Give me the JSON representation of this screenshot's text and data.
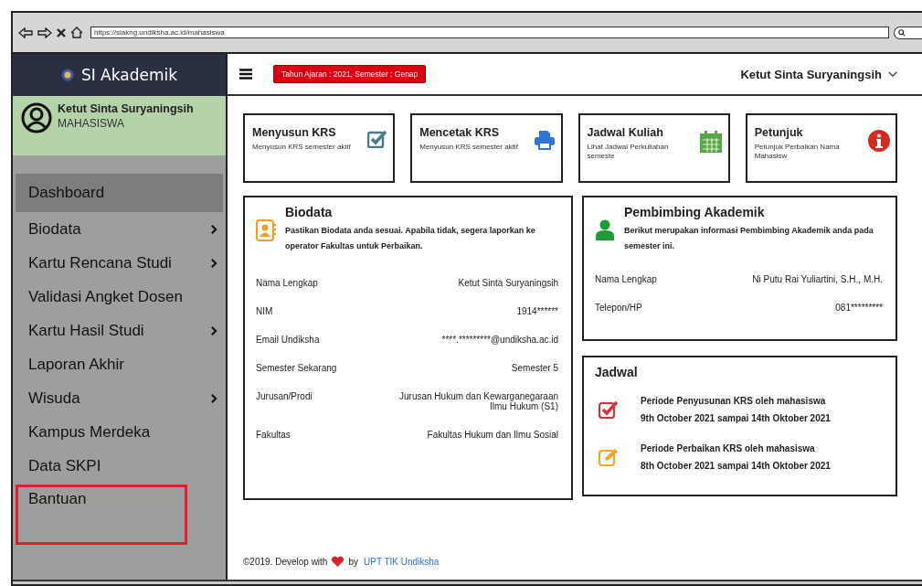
{
  "browser": {
    "url": "https://siakng.undiksha.ac.id/mahasiswa"
  },
  "sidebar": {
    "app_title": "SI Akademik",
    "user": {
      "name": "Ketut Sinta Suryaningsih",
      "role": "MAHASISWA"
    },
    "items": [
      {
        "label": "Dashboard",
        "selected": true,
        "submenu": false,
        "highlighted": false
      },
      {
        "label": "Biodata",
        "selected": false,
        "submenu": true,
        "highlighted": false
      },
      {
        "label": "Kartu Rencana Studi",
        "selected": false,
        "submenu": true,
        "highlighted": false
      },
      {
        "label": "Validasi Angket Dosen",
        "selected": false,
        "submenu": false,
        "highlighted": false
      },
      {
        "label": "Kartu Hasil Studi",
        "selected": false,
        "submenu": true,
        "highlighted": false
      },
      {
        "label": "Laporan Akhir",
        "selected": false,
        "submenu": false,
        "highlighted": false
      },
      {
        "label": "Wisuda",
        "selected": false,
        "submenu": true,
        "highlighted": false
      },
      {
        "label": "Kampus Merdeka",
        "selected": false,
        "submenu": false,
        "highlighted": false
      },
      {
        "label": "Data SKPI",
        "selected": false,
        "submenu": false,
        "highlighted": false
      },
      {
        "label": "Bantuan",
        "selected": false,
        "submenu": false,
        "highlighted": true
      }
    ]
  },
  "topbar": {
    "badge": "Tahun Ajaran : 2021, Semester : Genap",
    "user_name": "Ketut Sinta Suryaningsih"
  },
  "shortcuts": [
    {
      "title": "Menyusun KRS",
      "subtitle": "Menyusun KRS semester aktif"
    },
    {
      "title": "Mencetak KRS",
      "subtitle": "Menyusun KRS semester aktif"
    },
    {
      "title": "Jadwal Kuliah",
      "subtitle": "Lihat Jadwal Perkuliahan semeste"
    },
    {
      "title": "Petunjuk",
      "subtitle": "Petunjuk Perbaikan Nama Mahasisw"
    }
  ],
  "biodata": {
    "title": "Biodata",
    "note": "Pastikan Biodata anda sesuai. Apabila tidak, segera laporkan ke operator Fakultas untuk Perbaikan.",
    "fields": [
      {
        "label": "Nama Lengkap",
        "value": "Ketut Sinta Suryaningsih"
      },
      {
        "label": "NIM",
        "value": "1914******"
      },
      {
        "label": "Email Undiksha",
        "value": "****.*********@undiksha.ac.id"
      },
      {
        "label": "Semester Sekarang",
        "value": "Semester 5"
      },
      {
        "label": "Jurusan/Prodi",
        "value": "Jurusan Hukum dan Kewarganegaraan\nIlmu Hukum (S1)"
      },
      {
        "label": "Fakultas",
        "value": "Fakultas Hukum dan Ilmu Sosial"
      }
    ]
  },
  "advisor": {
    "title": "Pembimbing Akademik",
    "note": "Berikut merupakan informasi Pembimbing Akademik anda pada semester ini.",
    "fields": [
      {
        "label": "Nama Lengkap",
        "value": "Ni Putu Rai Yuliartini, S.H., M.H."
      },
      {
        "label": "Telepon/HP",
        "value": "081*********"
      }
    ]
  },
  "schedule": {
    "title": "Jadwal",
    "items": [
      {
        "title": "Periode Penyusunan KRS oleh mahasiswa",
        "dates": "9th October 2021 sampai 14th Oktober 2021"
      },
      {
        "title": "Periode Perbaikan KRS oleh mahasiswa",
        "dates": "8th October 2021 sampai 14th Oktober 2021"
      }
    ]
  },
  "footer": {
    "copyright": "©2019. Develop with",
    "by": "by",
    "link": "UPT TIK Undiksha"
  }
}
